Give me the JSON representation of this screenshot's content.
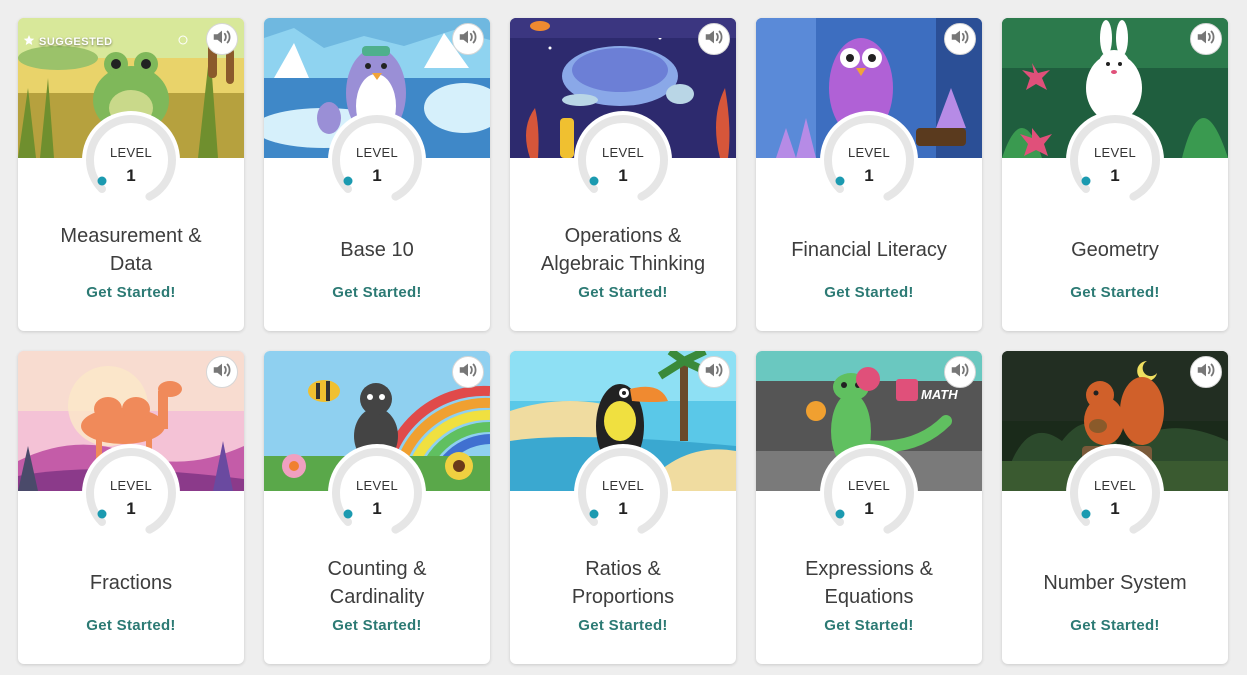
{
  "suggested_label": "SUGGESTED",
  "cards": [
    {
      "title": "Measurement & Data",
      "level_label": "LEVEL",
      "level": "1",
      "cta": "Get Started!",
      "suggested": true,
      "art": "frog"
    },
    {
      "title": "Base 10",
      "level_label": "LEVEL",
      "level": "1",
      "cta": "Get Started!",
      "art": "penguin"
    },
    {
      "title": "Operations & Algebraic Thinking",
      "level_label": "LEVEL",
      "level": "1",
      "cta": "Get Started!",
      "art": "turtle"
    },
    {
      "title": "Financial Literacy",
      "level_label": "LEVEL",
      "level": "1",
      "cta": "Get Started!",
      "art": "owl"
    },
    {
      "title": "Geometry",
      "level_label": "LEVEL",
      "level": "1",
      "cta": "Get Started!",
      "art": "bunny"
    },
    {
      "title": "Fractions",
      "level_label": "LEVEL",
      "level": "1",
      "cta": "Get Started!",
      "art": "camel"
    },
    {
      "title": "Counting & Cardinality",
      "level_label": "LEVEL",
      "level": "1",
      "cta": "Get Started!",
      "art": "ant"
    },
    {
      "title": "Ratios & Proportions",
      "level_label": "LEVEL",
      "level": "1",
      "cta": "Get Started!",
      "art": "toucan"
    },
    {
      "title": "Expressions & Equations",
      "level_label": "LEVEL",
      "level": "1",
      "cta": "Get Started!",
      "art": "gator",
      "art_text": "MATH"
    },
    {
      "title": "Number System",
      "level_label": "LEVEL",
      "level": "1",
      "cta": "Get Started!",
      "art": "squirrel"
    }
  ],
  "colors": {
    "cta": "#2c7a74",
    "progress_dot": "#1b9ab0",
    "ring": "#e6e6e6"
  },
  "icons": {
    "sound": "speaker-icon",
    "suggested": "star-icon"
  }
}
